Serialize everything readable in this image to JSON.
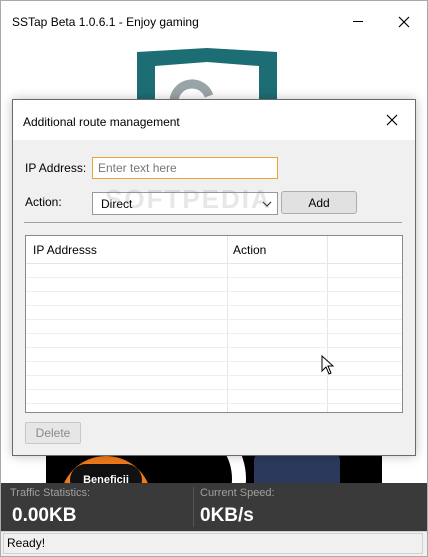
{
  "window": {
    "title": "SSTap Beta 1.0.6.1 - Enjoy gaming"
  },
  "promo": {
    "pill_label": "Beneficii"
  },
  "stats": {
    "traffic_label": "Traffic Statistics:",
    "traffic_value": "0.00KB",
    "speed_label": "Current Speed:",
    "speed_value": "0KB/s"
  },
  "status": {
    "text": "Ready!"
  },
  "dialog": {
    "title": "Additional route management",
    "ip_label": "IP Address:",
    "ip_placeholder": "Enter text here",
    "ip_value": "",
    "action_label": "Action:",
    "action_selected": "Direct",
    "add_label": "Add",
    "columns": [
      "IP Addresss",
      "Action"
    ],
    "delete_label": "Delete"
  },
  "watermark": "SOFTPEDIA",
  "colors": {
    "shield_teal": "#1d6e74",
    "input_focus": "#e8a33d",
    "stats_bg": "#3a3a3a",
    "promo_orange": "#f07a1a"
  },
  "icons": [
    "shield-icon",
    "close-icon",
    "minimize-icon",
    "chevron-down-icon",
    "cursor-icon"
  ]
}
